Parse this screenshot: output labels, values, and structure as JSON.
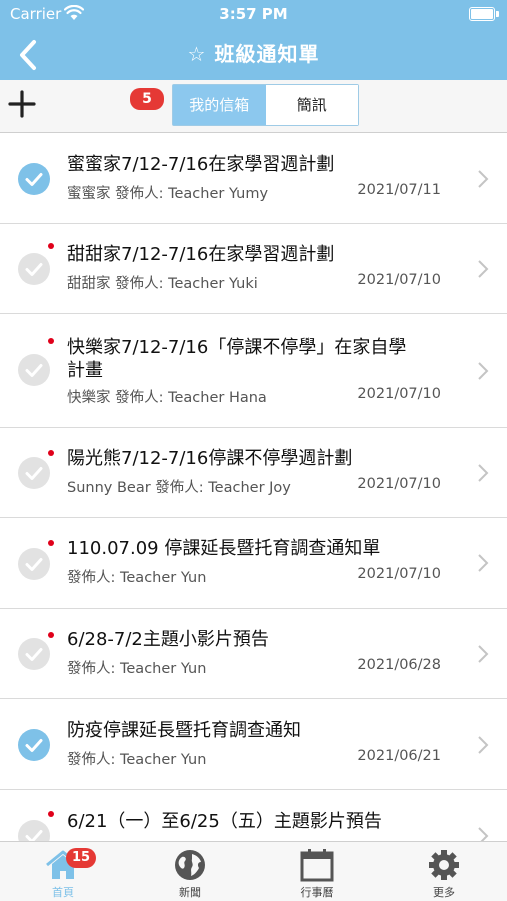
{
  "status_bar": {
    "carrier": "Carrier",
    "time": "3:57 PM"
  },
  "nav": {
    "title": "☆ 班級通知單"
  },
  "toolbar": {
    "unread_count": "5",
    "segments": [
      {
        "label": "我的信箱",
        "active": true
      },
      {
        "label": "簡訊",
        "active": false
      }
    ]
  },
  "notices": [
    {
      "title": "蜜蜜家7/12-7/16在家學習週計劃",
      "sender": "蜜蜜家 發佈人: Teacher Yumy",
      "date": "2021/07/11",
      "read": true
    },
    {
      "title": "甜甜家7/12-7/16在家學習週計劃",
      "sender": "甜甜家 發佈人: Teacher Yuki",
      "date": "2021/07/10",
      "read": false
    },
    {
      "title_line1": "快樂家7/12-7/16「停課不停學」在家自學",
      "title_line2": "計畫",
      "sender": "快樂家 發佈人: Teacher Hana",
      "date": "2021/07/10",
      "read": false
    },
    {
      "title": "陽光熊7/12-7/16停課不停學週計劃",
      "sender": "Sunny Bear 發佈人: Teacher Joy",
      "date": "2021/07/10",
      "read": false
    },
    {
      "title": "110.07.09 停課延長暨托育調查通知單",
      "sender": "發佈人: Teacher Yun",
      "date": "2021/07/10",
      "read": false
    },
    {
      "title": "6/28-7/2主題小影片預告",
      "sender": "發佈人: Teacher Yun",
      "date": "2021/06/28",
      "read": false
    },
    {
      "title": "防疫停課延長暨托育調查通知",
      "sender": "發佈人: Teacher Yun",
      "date": "2021/06/21",
      "read": true
    },
    {
      "title": "6/21（一）至6/25（五）主題影片預告",
      "sender": "",
      "date": "",
      "read": false
    }
  ],
  "tabbar": {
    "home_badge": "15",
    "items": [
      {
        "label": "首頁",
        "icon": "home-icon",
        "active": true
      },
      {
        "label": "新聞",
        "icon": "globe-icon",
        "active": false
      },
      {
        "label": "行事曆",
        "icon": "calendar-icon",
        "active": false
      },
      {
        "label": "更多",
        "icon": "gear-icon",
        "active": false
      }
    ]
  },
  "colors": {
    "accent": "#7ec1e8",
    "badge": "#e53935",
    "unread_dot": "#e0001a"
  }
}
